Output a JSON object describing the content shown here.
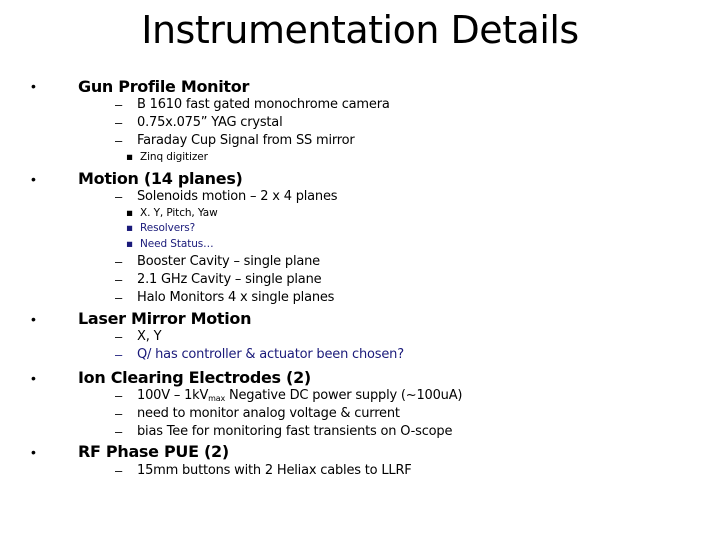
{
  "title": "Instrumentation Details",
  "colors": {
    "text": "#000000",
    "note": "#1a1a7a",
    "background": "#ffffff"
  },
  "sections": [
    {
      "heading": "Gun Profile Monitor",
      "items": [
        {
          "text": "B 1610 fast gated monochrome camera"
        },
        {
          "text": "0.75x.075” YAG crystal"
        },
        {
          "text": "Faraday Cup Signal from SS mirror",
          "sub": [
            "Zinq digitizer"
          ]
        }
      ]
    },
    {
      "heading": "Motion (14 planes)",
      "items": [
        {
          "text": "Solenoids motion – 2 x 4 planes",
          "sub": [
            "X. Y, Pitch, Yaw",
            "Resolvers?",
            "Need Status…"
          ]
        },
        {
          "text": "Booster Cavity – single plane"
        },
        {
          "text": "2.1 GHz Cavity – single plane"
        },
        {
          "text": "Halo Monitors 4 x single planes"
        }
      ]
    },
    {
      "heading": "Laser Mirror Motion",
      "items": [
        {
          "text": "X, Y"
        },
        {
          "text": "Q/ has controller & actuator been chosen?"
        }
      ]
    },
    {
      "heading": "Ion Clearing Electrodes (2)",
      "items": [
        {
          "text_pre": "100V – 1kV",
          "text_sub": "max",
          "text_post": " Negative DC power supply (~100uA)"
        },
        {
          "text": "need to monitor analog voltage & current"
        },
        {
          "text": "bias Tee for monitoring fast transients on O-scope"
        }
      ]
    },
    {
      "heading": "RF Phase PUE (2)",
      "items": [
        {
          "text": "15mm buttons with 2 Heliax cables to LLRF"
        }
      ]
    }
  ],
  "glyphs": {
    "bullet": "•",
    "dash": "–",
    "sub_bullet": "▪"
  }
}
